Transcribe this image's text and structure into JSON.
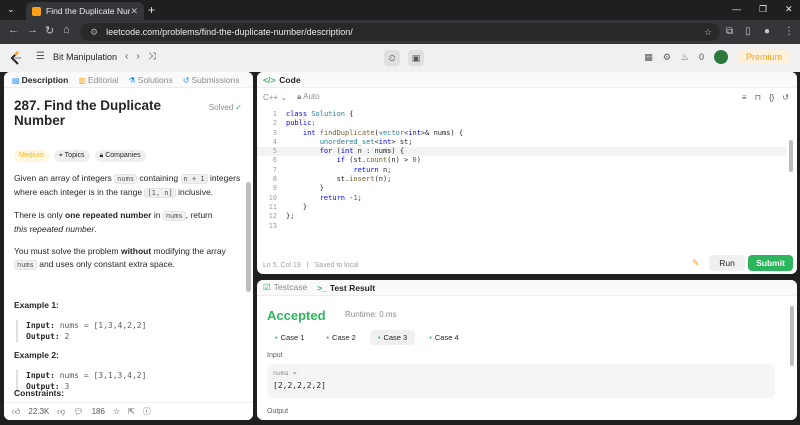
{
  "browser": {
    "tab_title": "Find the Duplicate Number - Le",
    "url": "leetcode.com/problems/find-the-duplicate-number/description/"
  },
  "header": {
    "list_name": "Bit Manipulation",
    "streak": "0",
    "premium": "Premium"
  },
  "left": {
    "tabs": [
      "Description",
      "Editorial",
      "Solutions",
      "Submissions"
    ],
    "title": "287. Find the Duplicate Number",
    "solved": "Solved",
    "chips": [
      "Medium",
      "Topics",
      "Companies"
    ],
    "desc1": {
      "a": "Given an array of integers ",
      "c1": "nums",
      "b": " containing ",
      "c2": "n + 1",
      "c": " integers where each integer is in the range ",
      "c3": "[1, n]",
      "d": " inclusive."
    },
    "desc2": {
      "a": "There is only ",
      "b": "one repeated number",
      "c": " in ",
      "c1": "nums",
      "d": ", return",
      "e": "this repeated number",
      "f": "."
    },
    "desc3": {
      "a": "You must solve the problem ",
      "b": "without",
      "c": " modifying the array ",
      "c1": "nums",
      "d": " and uses only constant extra space."
    },
    "ex1": {
      "title": "Example 1:",
      "input_label": "Input:",
      "input": "nums = [1,3,4,2,2]",
      "output_label": "Output:",
      "output": "2"
    },
    "ex2": {
      "title": "Example 2:",
      "input_label": "Input:",
      "input": "nums = [3,1,3,4,2]",
      "output_label": "Output:",
      "output": "3"
    },
    "constraints": "Constraints:",
    "likes": "22.3K",
    "comments": "186"
  },
  "code": {
    "title": "Code",
    "language": "C++",
    "mode": "Auto",
    "cursor": "Ln 5, Col 19",
    "saved": "Saved to local",
    "run": "Run",
    "submit": "Submit"
  },
  "result": {
    "tabs": [
      "Testcase",
      "Test Result"
    ],
    "status": "Accepted",
    "runtime": "Runtime: 0 ms",
    "cases": [
      "Case 1",
      "Case 2",
      "Case 3",
      "Case 4"
    ],
    "input_label": "Input",
    "var": "nums =",
    "value": "[2,2,2,2,2]",
    "output_label": "Output"
  }
}
